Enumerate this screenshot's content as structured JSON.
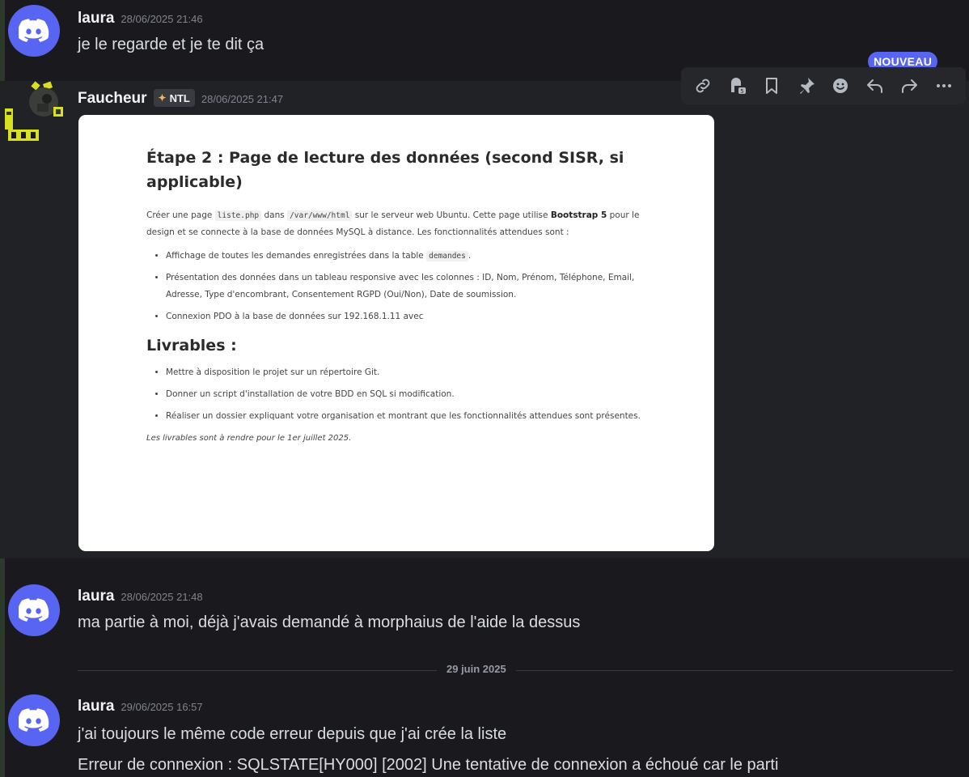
{
  "messages": [
    {
      "author": "laura",
      "timestamp": "28/06/2025 21:46",
      "lines": [
        "je le regarde et je te dit ça"
      ]
    },
    {
      "author": "Faucheur",
      "tag": "NTL",
      "timestamp": "28/06/2025 21:47"
    },
    {
      "author": "laura",
      "timestamp": "28/06/2025 21:48",
      "lines": [
        "ma partie à moi, déjà j'avais demandé à morphaius de l'aide la dessus"
      ]
    },
    {
      "author": "laura",
      "timestamp": "29/06/2025 16:57",
      "lines": [
        "j'ai toujours le même code erreur depuis que j'ai crée la liste",
        "Erreur de connexion : SQLSTATE[HY000] [2002] Une tentative de connexion a échoué car le parti"
      ]
    }
  ],
  "date_divider": "29 juin 2025",
  "new_badge": "NOUVEAU",
  "toolbar_icons": [
    "link-icon",
    "thread-icon",
    "bookmark-icon",
    "pin-icon",
    "emoji-icon",
    "reply-icon",
    "forward-icon",
    "more-icon"
  ],
  "attachment": {
    "heading": "Étape 2 : Page de lecture des données (second SISR, si applicable)",
    "intro_1": "Créer une page ",
    "code_file": "liste.php",
    "intro_2": " dans ",
    "code_path": "/var/www/html",
    "intro_3": " sur le serveur web Ubuntu. Cette page utilise ",
    "intro_bold": "Bootstrap 5",
    "intro_4": " pour le design et se connecte à la base de données MySQL à distance. Les fonctionnalités attendues sont :",
    "bullet_1_text": "Affichage de toutes les demandes enregistrées dans la table ",
    "bullet_1_code": "demandes",
    "bullet_1_end": ".",
    "bullet_2": "Présentation des données dans un tableau responsive avec les colonnes : ID, Nom, Prénom, Téléphone, Email, Adresse, Type d'encombrant, Consentement RGPD (Oui/Non), Date de soumission.",
    "bullet_3": "Connexion PDO à la base de données sur 192.168.1.11 avec",
    "livrables_heading": "Livrables :",
    "livrables": [
      "Mettre à disposition le projet sur un répertoire Git.",
      "Donner un script d'installation de votre BDD en SQL si modification.",
      "Réaliser un dossier expliquant votre organisation et montrant que les fonctionnalités attendues sont présentes."
    ],
    "note": "Les livrables sont à rendre pour le 1er juillet 2025."
  },
  "colors": {
    "background": "#1a1a1e",
    "hover_row": "#202226",
    "blurple": "#5865f2",
    "text": "#dbdee1",
    "timestamp": "#80848e"
  }
}
